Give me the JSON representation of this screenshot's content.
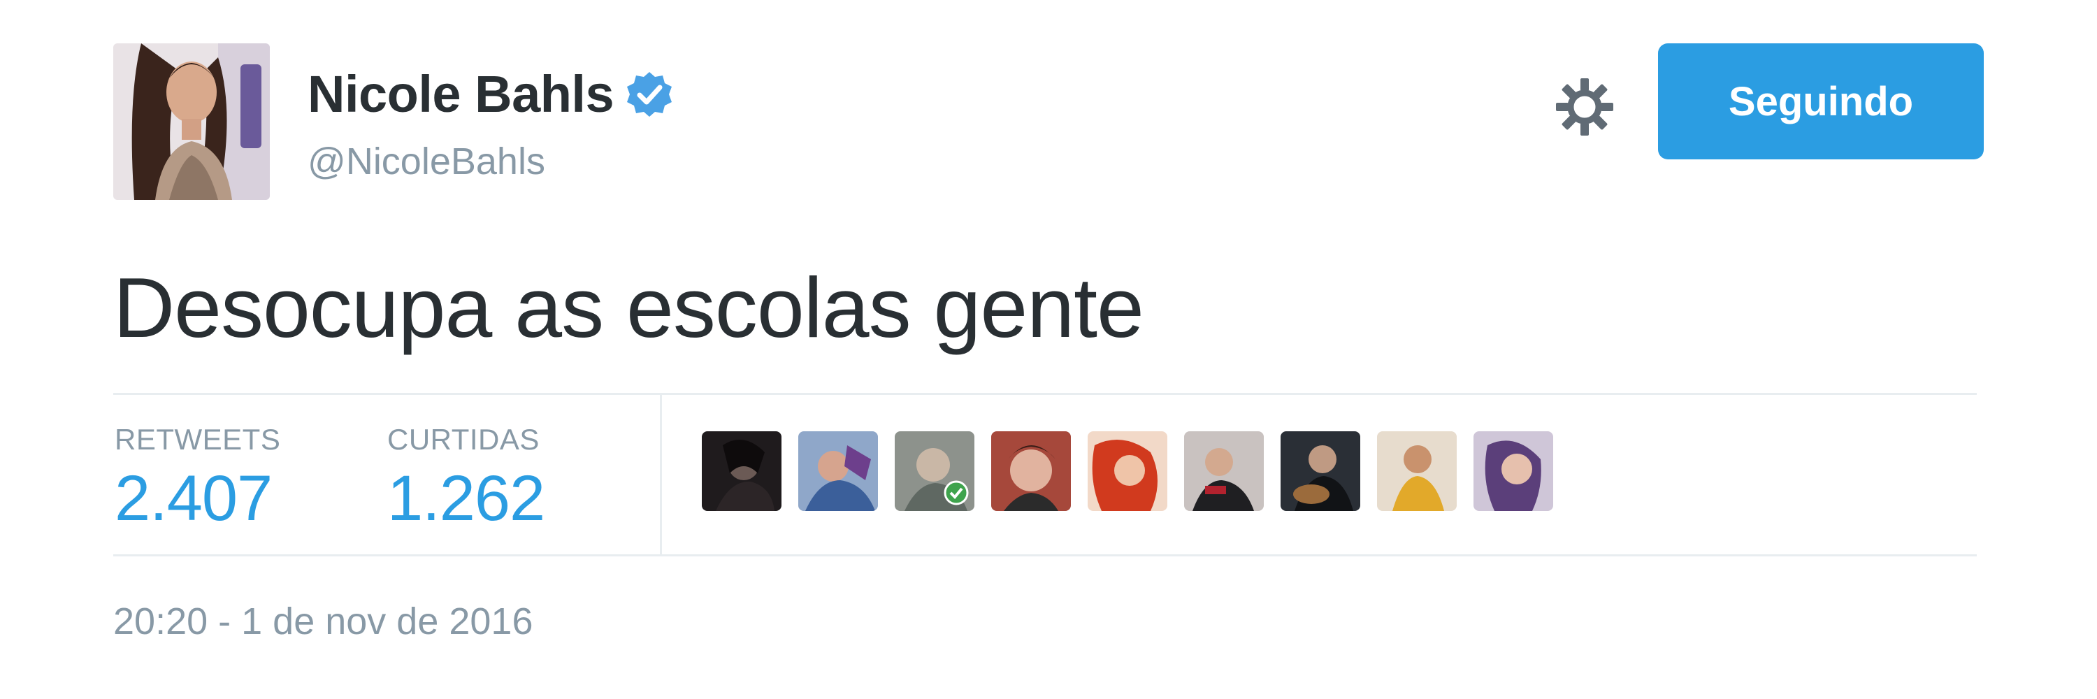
{
  "user": {
    "display_name": "Nicole Bahls",
    "handle": "@NicoleBahls",
    "verified": true
  },
  "actions": {
    "follow_label": "Seguindo",
    "settings_icon": "gear-icon"
  },
  "tweet": {
    "text": "Desocupa as escolas gente",
    "timestamp": "20:20 - 1 de nov de 2016"
  },
  "stats": {
    "retweets_label": "RETWEETS",
    "retweets_value": "2.407",
    "likes_label": "CURTIDAS",
    "likes_value": "1.262"
  },
  "liked_by_count_shown": 9,
  "colors": {
    "accent": "#2b9de2",
    "text": "#292f33",
    "muted": "#8899a6",
    "verified": "#4aa1e5"
  }
}
